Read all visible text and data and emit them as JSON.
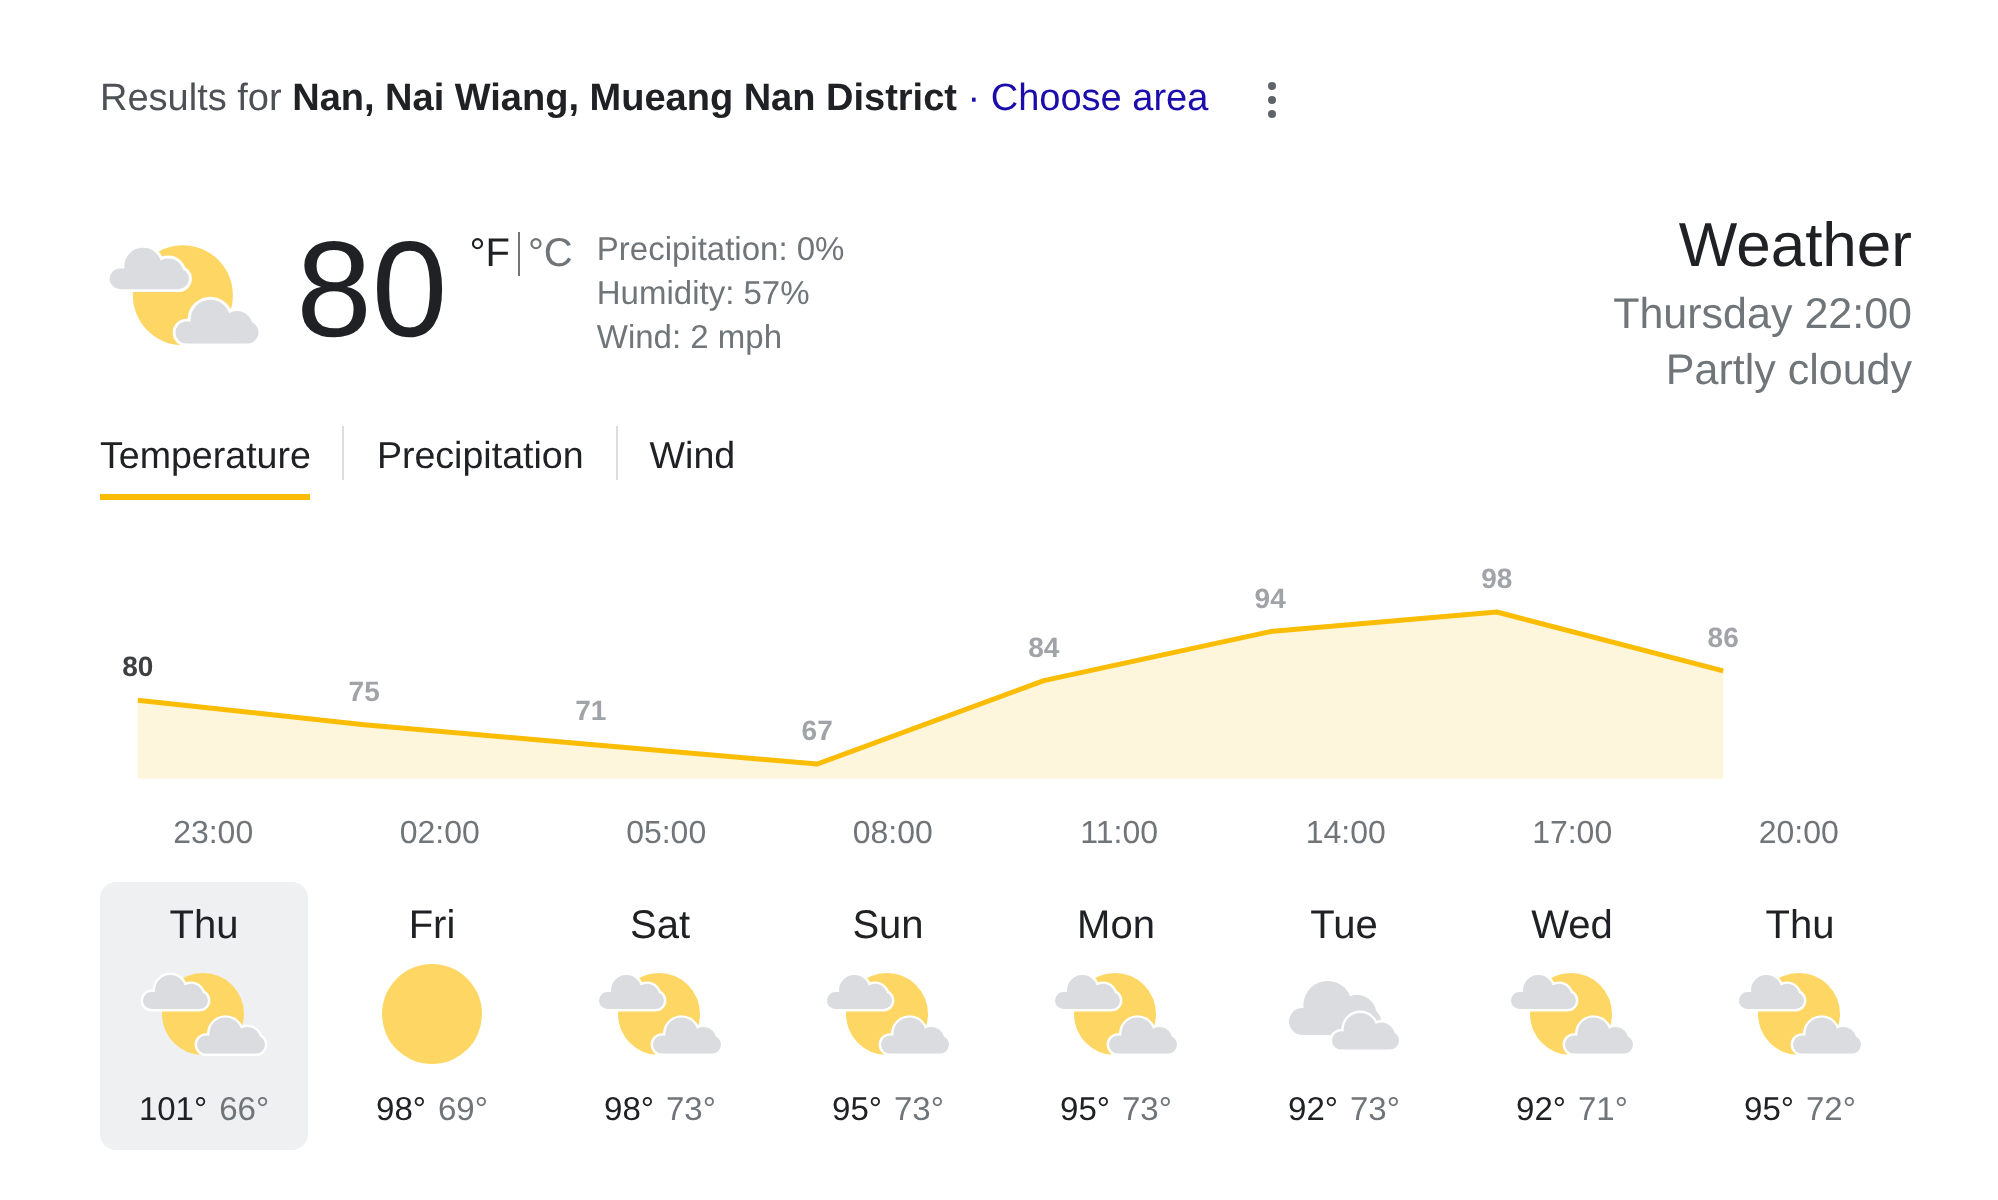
{
  "header": {
    "results_text": "Results for **Nan, Nai Wiang, Mueang Nan District**",
    "separator": "·",
    "link": "Choose area"
  },
  "current": {
    "kind": "partly-cloudy",
    "temperature": "80",
    "units": [
      {
        "label": "°F",
        "selected": true
      },
      {
        "label": "°C",
        "selected": false
      }
    ],
    "details": [
      "Precipitation: 0%",
      "Humidity: 57%",
      "Wind: 2 mph"
    ]
  },
  "summary": {
    "title": "Weather",
    "time": "Thursday 22:00",
    "condition": "Partly cloudy"
  },
  "tabs": [
    {
      "label": "Temperature",
      "selected": true
    },
    {
      "label": "Precipitation",
      "selected": false
    },
    {
      "label": "Wind",
      "selected": false
    }
  ],
  "temperature_chart": {
    "chart_data": {
      "type": "area",
      "categories": [
        null,
        "23:00",
        null,
        null,
        "02:00",
        null,
        null,
        "05:00",
        null,
        null,
        "08:00",
        null,
        null,
        "11:00",
        null,
        null,
        "14:00",
        null,
        null,
        "17:00",
        null,
        null,
        "20:00",
        null
      ],
      "series": [
        {
          "color": "#fbbc04",
          "values": [
            80,
            null,
            null,
            75,
            null,
            null,
            71,
            null,
            null,
            67,
            null,
            null,
            84,
            null,
            null,
            94,
            null,
            null,
            98,
            null,
            null,
            86,
            null,
            null
          ]
        }
      ],
      "data_labels": true
    },
    "labelled_hours": [
      {
        "selected": true
      },
      {
        "selected": false
      },
      {
        "selected": false
      },
      {
        "selected": false
      },
      {
        "selected": false
      },
      {
        "selected": false
      },
      {
        "selected": false
      },
      {
        "selected": false
      }
    ]
  },
  "days": [
    {
      "name": "Thu",
      "kind": "partly-cloudy",
      "high": "101°",
      "low": "66°",
      "selected": true
    },
    {
      "name": "Fri",
      "kind": "sunny",
      "high": "98°",
      "low": "69°",
      "selected": false
    },
    {
      "name": "Sat",
      "kind": "partly-cloudy",
      "high": "98°",
      "low": "73°",
      "selected": false
    },
    {
      "name": "Sun",
      "kind": "partly-cloudy",
      "high": "95°",
      "low": "73°",
      "selected": false
    },
    {
      "name": "Mon",
      "kind": "partly-cloudy",
      "high": "95°",
      "low": "73°",
      "selected": false
    },
    {
      "name": "Tue",
      "kind": "cloudy",
      "high": "92°",
      "low": "73°",
      "selected": false
    },
    {
      "name": "Wed",
      "kind": "partly-cloudy",
      "high": "92°",
      "low": "71°",
      "selected": false
    },
    {
      "name": "Thu",
      "kind": "partly-cloudy",
      "high": "95°",
      "low": "72°",
      "selected": false
    }
  ]
}
